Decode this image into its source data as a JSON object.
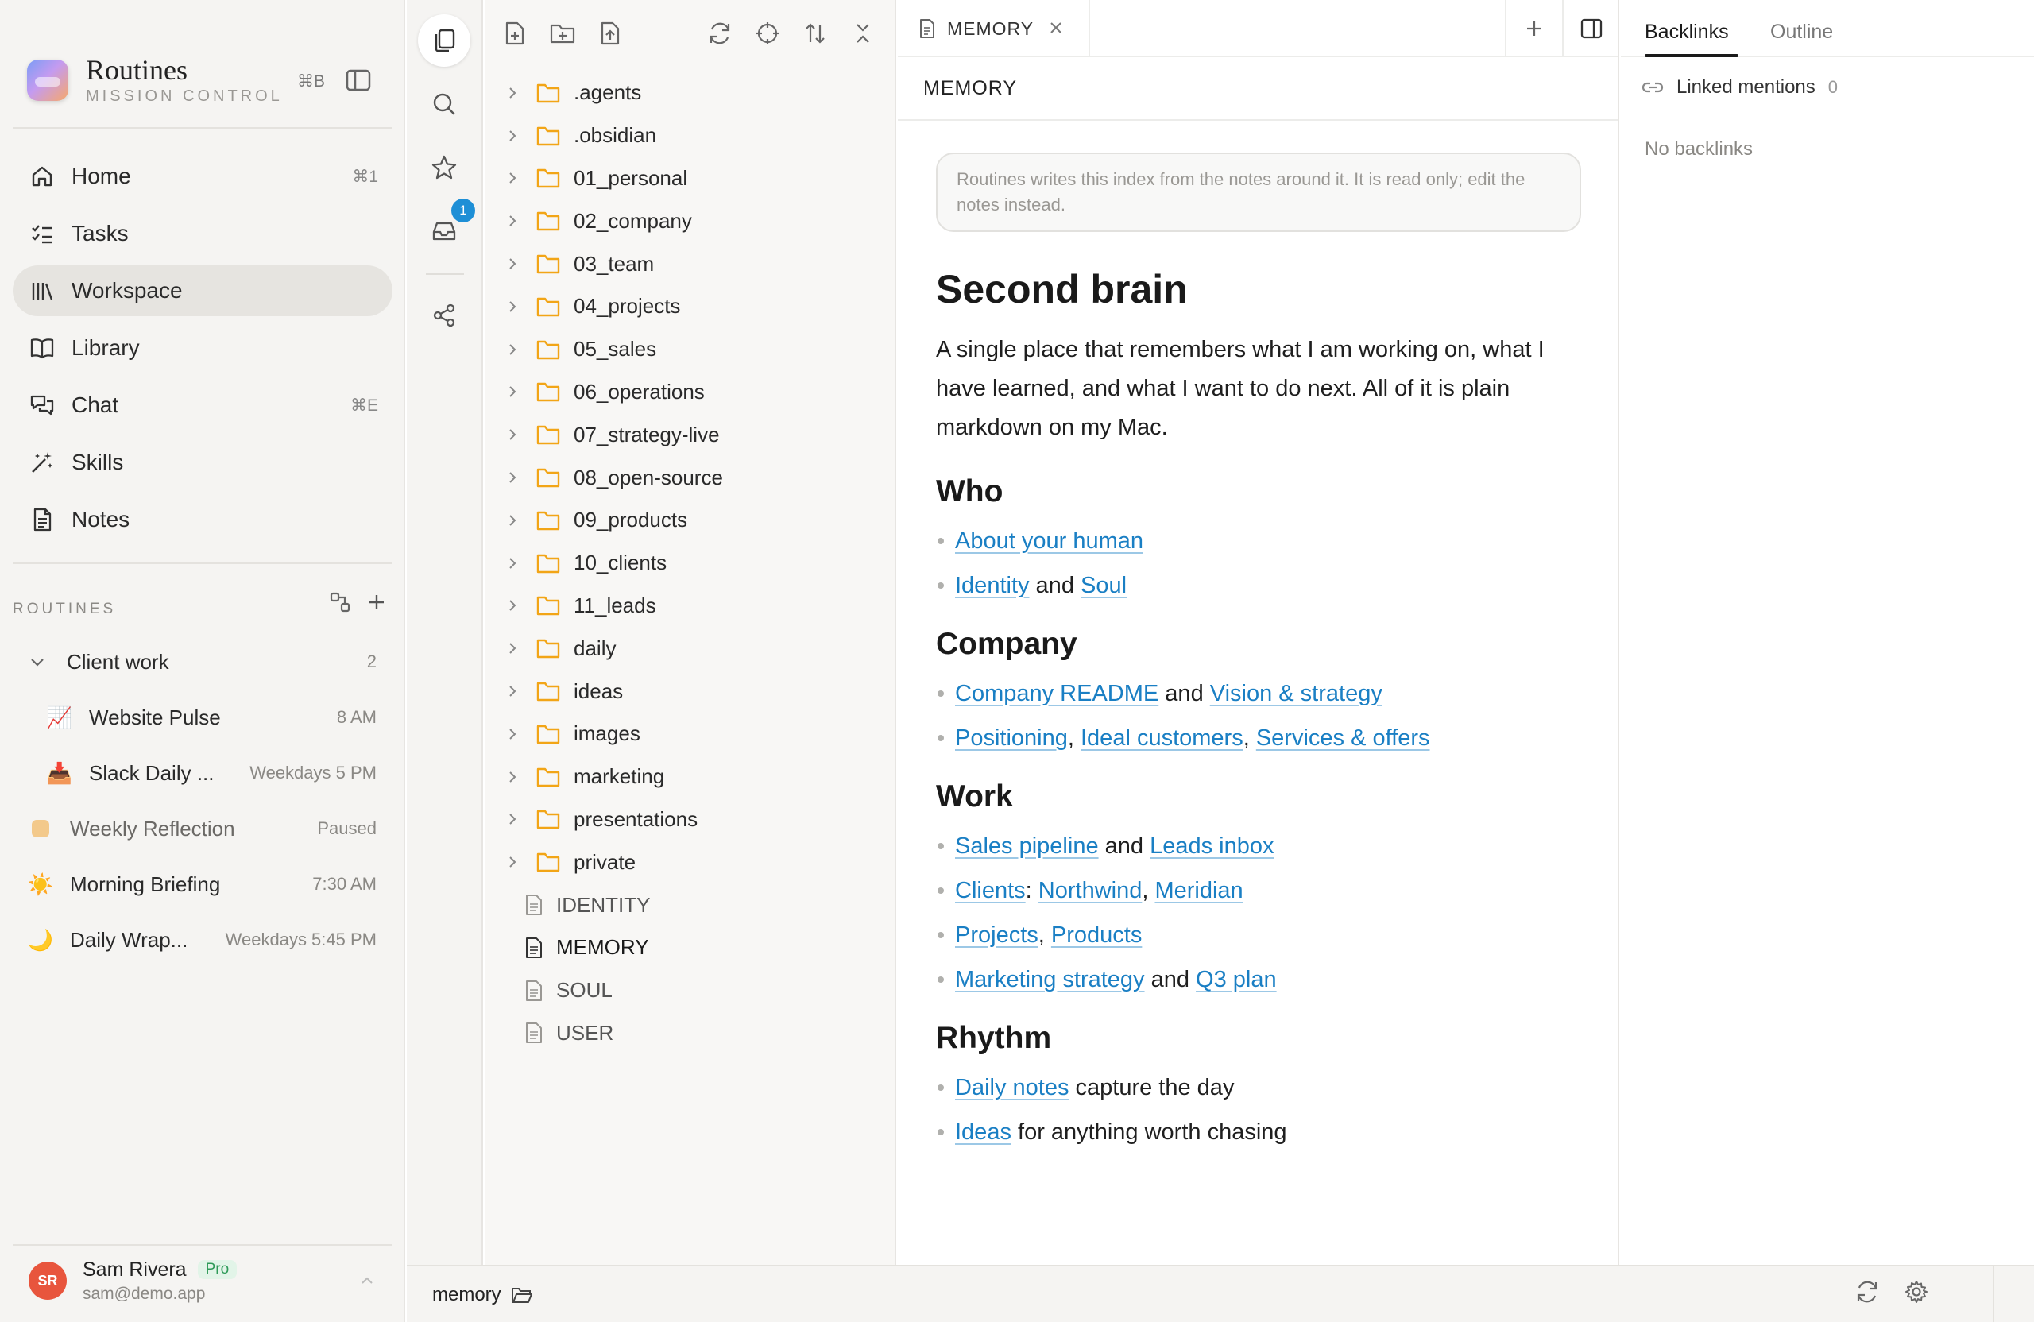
{
  "app": {
    "title": "Routines",
    "subtitle": "MISSION CONTROL",
    "sidebar_shortcut": "⌘B"
  },
  "nav": {
    "items": [
      {
        "label": "Home",
        "shortcut": "⌘1",
        "icon": "home-icon"
      },
      {
        "label": "Tasks",
        "shortcut": "",
        "icon": "tasks-icon"
      },
      {
        "label": "Workspace",
        "shortcut": "",
        "icon": "library-shelf-icon",
        "active": true
      },
      {
        "label": "Library",
        "shortcut": "",
        "icon": "book-icon"
      },
      {
        "label": "Chat",
        "shortcut": "⌘E",
        "icon": "chat-icon"
      },
      {
        "label": "Skills",
        "shortcut": "",
        "icon": "magic-wand-icon"
      },
      {
        "label": "Notes",
        "shortcut": "",
        "icon": "note-icon"
      }
    ]
  },
  "routines": {
    "section_label": "ROUTINES",
    "group": {
      "label": "Client work",
      "count": "2"
    },
    "items": [
      {
        "emoji": "📈",
        "label": "Website Pulse",
        "meta": "8 AM"
      },
      {
        "emoji": "📥",
        "label": "Slack Daily ...",
        "meta": "Weekdays 5 PM"
      },
      {
        "emoji": "",
        "label": "Weekly Reflection",
        "meta": "Paused"
      },
      {
        "emoji": "☀️",
        "label": "Morning Briefing",
        "meta": "7:30 AM"
      },
      {
        "emoji": "🌙",
        "label": "Daily Wrap...",
        "meta": "Weekdays 5:45 PM"
      }
    ]
  },
  "user": {
    "initials": "SR",
    "name": "Sam Rivera",
    "plan": "Pro",
    "email": "sam@demo.app"
  },
  "rail": {
    "inbox_badge": "1"
  },
  "tree": {
    "folders": [
      ".agents",
      ".obsidian",
      "01_personal",
      "02_company",
      "03_team",
      "04_projects",
      "05_sales",
      "06_operations",
      "07_strategy-live",
      "08_open-source",
      "09_products",
      "10_clients",
      "11_leads",
      "daily",
      "ideas",
      "images",
      "marketing",
      "presentations",
      "private"
    ],
    "files": [
      "IDENTITY",
      "MEMORY",
      "SOUL",
      "USER"
    ],
    "current_file": "MEMORY"
  },
  "editor": {
    "tab_label": "MEMORY",
    "doc_title_bar": "MEMORY",
    "notice": "Routines writes this index from the notes around it. It is read only; edit the notes instead.",
    "h1": "Second brain",
    "lead": "A single place that remembers what I am working on, what I have learned, and what I want to do next. All of it is plain markdown on my Mac.",
    "sections": [
      {
        "heading": "Who",
        "items": [
          [
            {
              "link": "About your human"
            }
          ],
          [
            {
              "link": "Identity"
            },
            {
              "text": " and "
            },
            {
              "link": "Soul"
            }
          ]
        ]
      },
      {
        "heading": "Company",
        "items": [
          [
            {
              "link": "Company README"
            },
            {
              "text": " and "
            },
            {
              "link": "Vision & strategy"
            }
          ],
          [
            {
              "link": "Positioning"
            },
            {
              "text": ", "
            },
            {
              "link": "Ideal customers"
            },
            {
              "text": ", "
            },
            {
              "link": "Services & offers"
            }
          ]
        ]
      },
      {
        "heading": "Work",
        "items": [
          [
            {
              "link": "Sales pipeline"
            },
            {
              "text": " and "
            },
            {
              "link": "Leads inbox"
            }
          ],
          [
            {
              "link": "Clients"
            },
            {
              "text": ": "
            },
            {
              "link": "Northwind"
            },
            {
              "text": ", "
            },
            {
              "link": "Meridian"
            }
          ],
          [
            {
              "link": "Projects"
            },
            {
              "text": ", "
            },
            {
              "link": "Products"
            }
          ],
          [
            {
              "link": "Marketing strategy"
            },
            {
              "text": " and "
            },
            {
              "link": "Q3 plan"
            }
          ]
        ]
      },
      {
        "heading": "Rhythm",
        "items": [
          [
            {
              "link": "Daily notes"
            },
            {
              "text": " capture the day"
            }
          ],
          [
            {
              "link": "Ideas"
            },
            {
              "text": " for anything worth chasing"
            }
          ]
        ]
      }
    ]
  },
  "right_panel": {
    "tabs": [
      "Backlinks",
      "Outline"
    ],
    "active_tab": "Backlinks",
    "linked_mentions_label": "Linked mentions",
    "linked_mentions_count": "0",
    "empty_text": "No backlinks"
  },
  "status": {
    "path": "memory"
  },
  "colors": {
    "link": "#1a7fc4",
    "badge": "#1e8fd6",
    "avatar": "#e8553d",
    "folder": "#f2a516",
    "pro_badge": "#2e9a58"
  }
}
